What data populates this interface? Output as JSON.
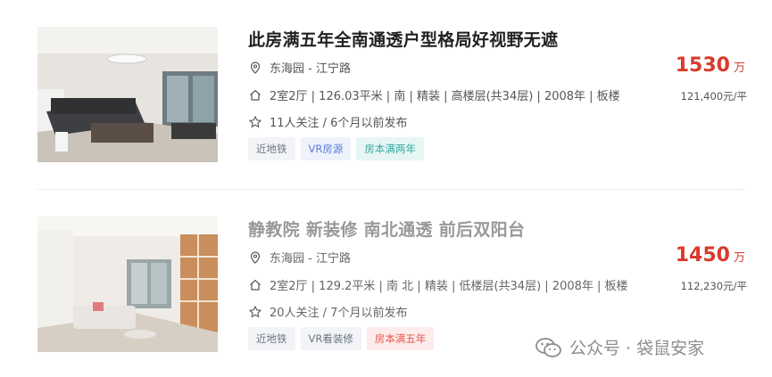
{
  "listings": [
    {
      "title": "此房满五年全南通透户型格局好视野无遮",
      "location": "东海园 - 江宁路",
      "info": "2室2厅 | 126.03平米 | 南 | 精装 | 高楼层(共34层) | 2008年 | 板楼",
      "follow": "11人关注 / 6个月以前发布",
      "tags": [
        "近地铁",
        "VR房源",
        "房本满两年"
      ],
      "price": "1530",
      "price_unit": "万",
      "unit_price": "121,400元/平"
    },
    {
      "title": "静教院 新装修 南北通透 前后双阳台",
      "location": "东海园 - 江宁路",
      "info": "2室2厅 | 129.2平米 | 南 北 | 精装 | 低楼层(共34层) | 2008年 | 板楼",
      "follow": "20人关注 / 7个月以前发布",
      "tags": [
        "近地铁",
        "VR看装修",
        "房本满五年"
      ],
      "price": "1450",
      "price_unit": "万",
      "unit_price": "112,230元/平"
    }
  ],
  "watermark": {
    "text": "公众号 · 袋鼠安家"
  },
  "icons": {
    "location": "location-pin-icon",
    "house": "house-icon",
    "star": "star-icon"
  },
  "colors": {
    "price": "#d83b2d",
    "tag_vr": "#5a7bd6",
    "tag_teal": "#3aa8a1",
    "tag_pink": "#e05a4f"
  }
}
